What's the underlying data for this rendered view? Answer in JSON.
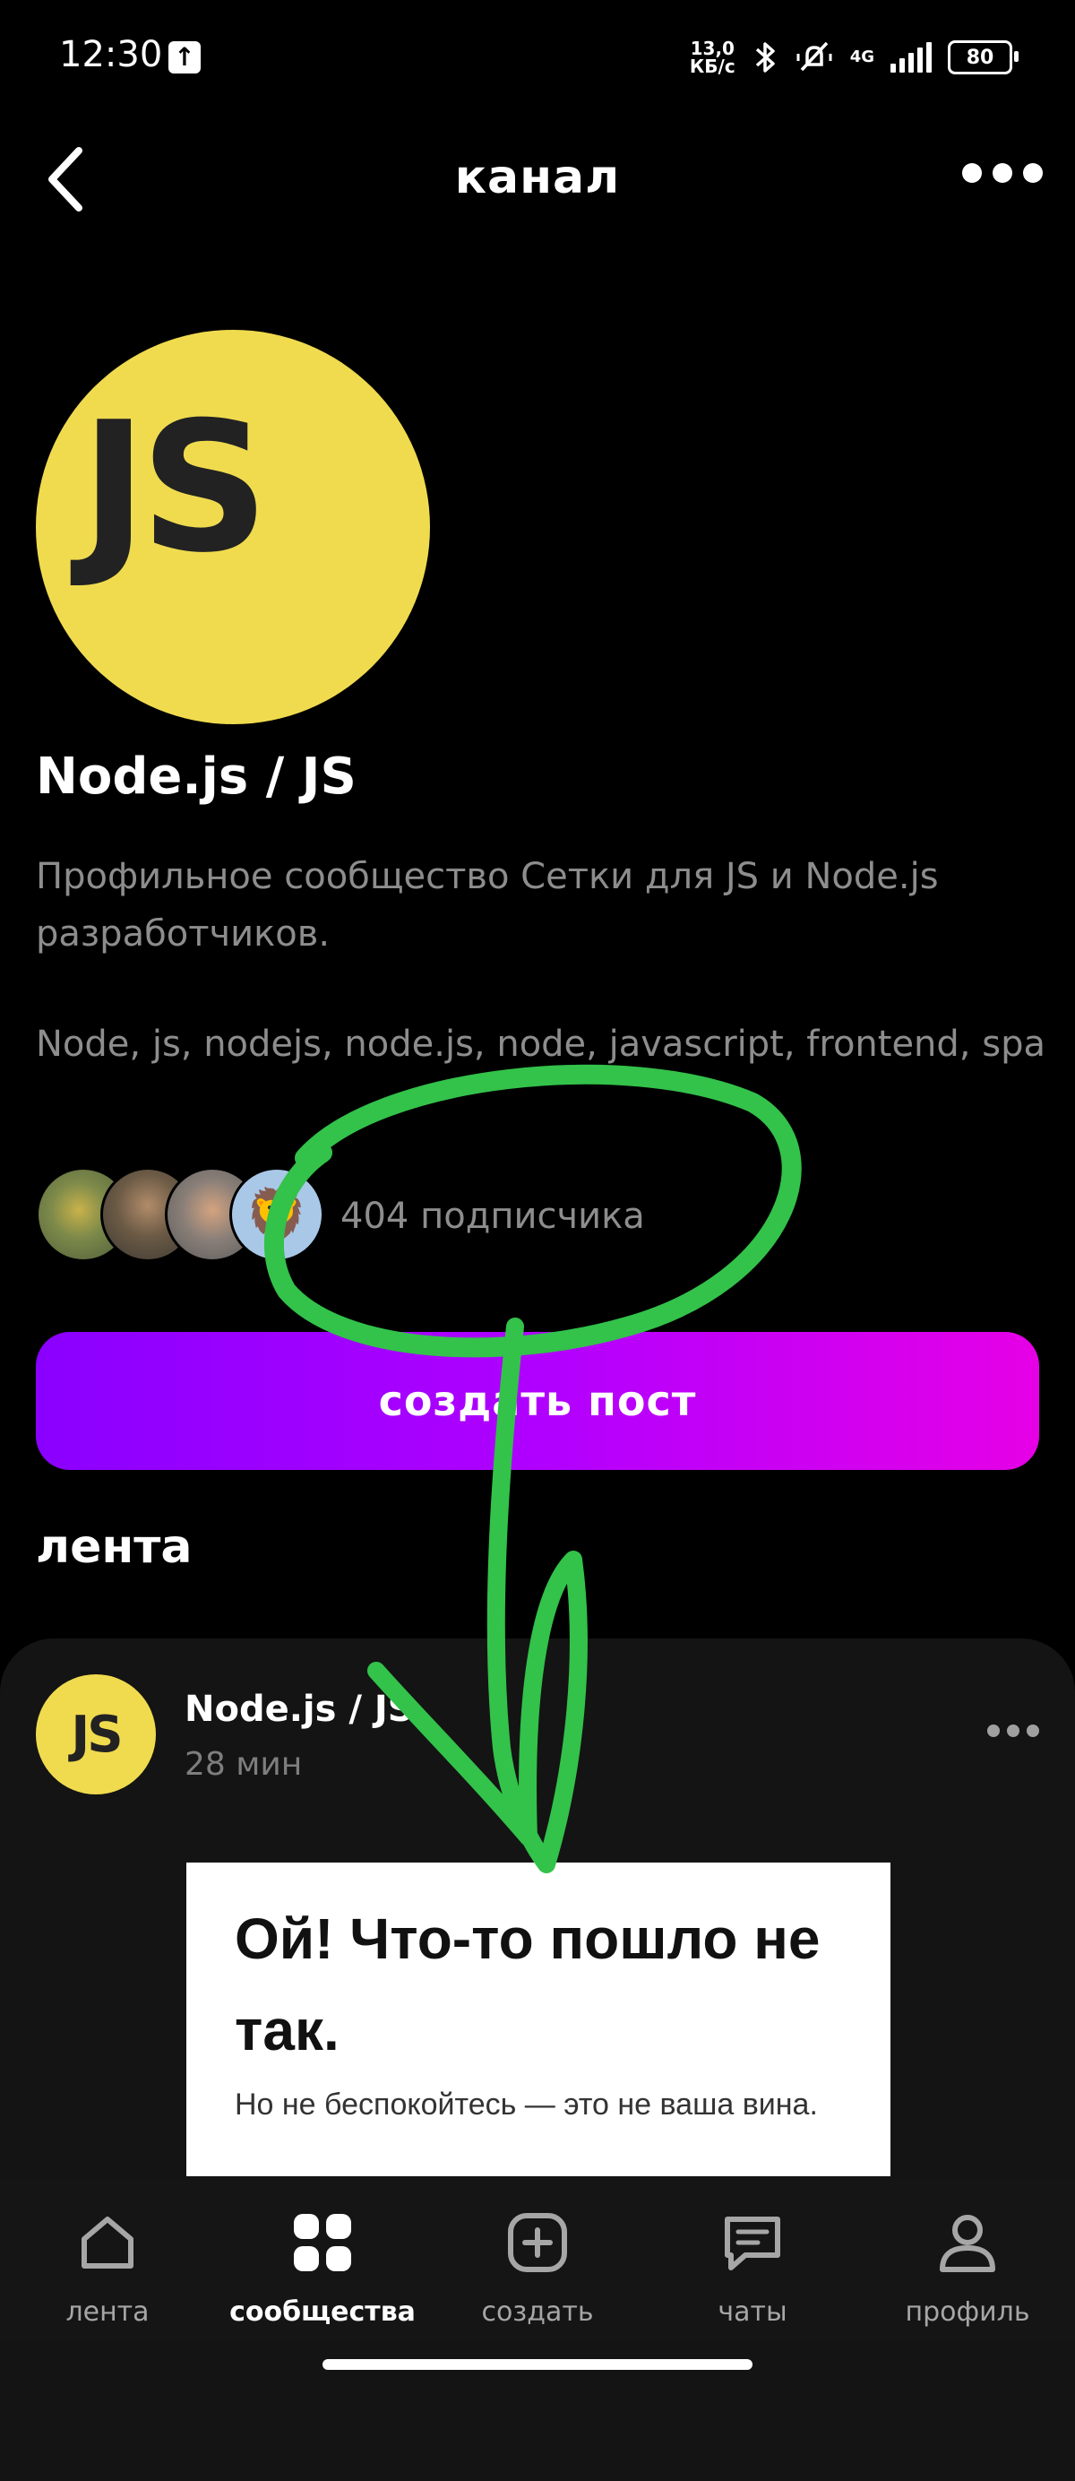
{
  "status_bar": {
    "time": "12:30",
    "net_speed_value": "13,0",
    "net_speed_unit": "КБ/с",
    "net_type": "4G",
    "battery": "80"
  },
  "header": {
    "title": "канал",
    "back_icon": "chevron-left-icon",
    "more_icon": "more-horizontal-icon"
  },
  "channel": {
    "avatar_text": "JS",
    "name": "Node.js / JS",
    "description": "Профильное сообщество Сетки для JS и Node.js разработчиков.",
    "tags": "Node, js, nodejs, node.js, node, javascript, frontend, spa",
    "subscribers": "404 подписчика",
    "subscriber_avatar_icon": "lion-emoji",
    "subscriber_avatar_emoji": "🦁"
  },
  "actions": {
    "create_post": "создать пост"
  },
  "feed": {
    "title": "лента",
    "post": {
      "avatar_text": "JS",
      "author": "Node.js / JS",
      "time": "28 мин",
      "image_title": "Ой! Что-то пошло не так.",
      "image_subtitle": "Но не беспокойтесь — это не ваша вина."
    }
  },
  "nav": {
    "items": [
      {
        "label": "лента",
        "icon": "home-icon"
      },
      {
        "label": "сообщества",
        "icon": "grid-icon"
      },
      {
        "label": "создать",
        "icon": "plus-square-icon"
      },
      {
        "label": "чаты",
        "icon": "chat-icon"
      },
      {
        "label": "профиль",
        "icon": "user-icon"
      }
    ],
    "active_index": 1
  },
  "colors": {
    "js_yellow": "#F0DB4F",
    "button_gradient_start": "#8a00ff",
    "button_gradient_end": "#e600e6",
    "annotation_green": "#33c24a"
  }
}
